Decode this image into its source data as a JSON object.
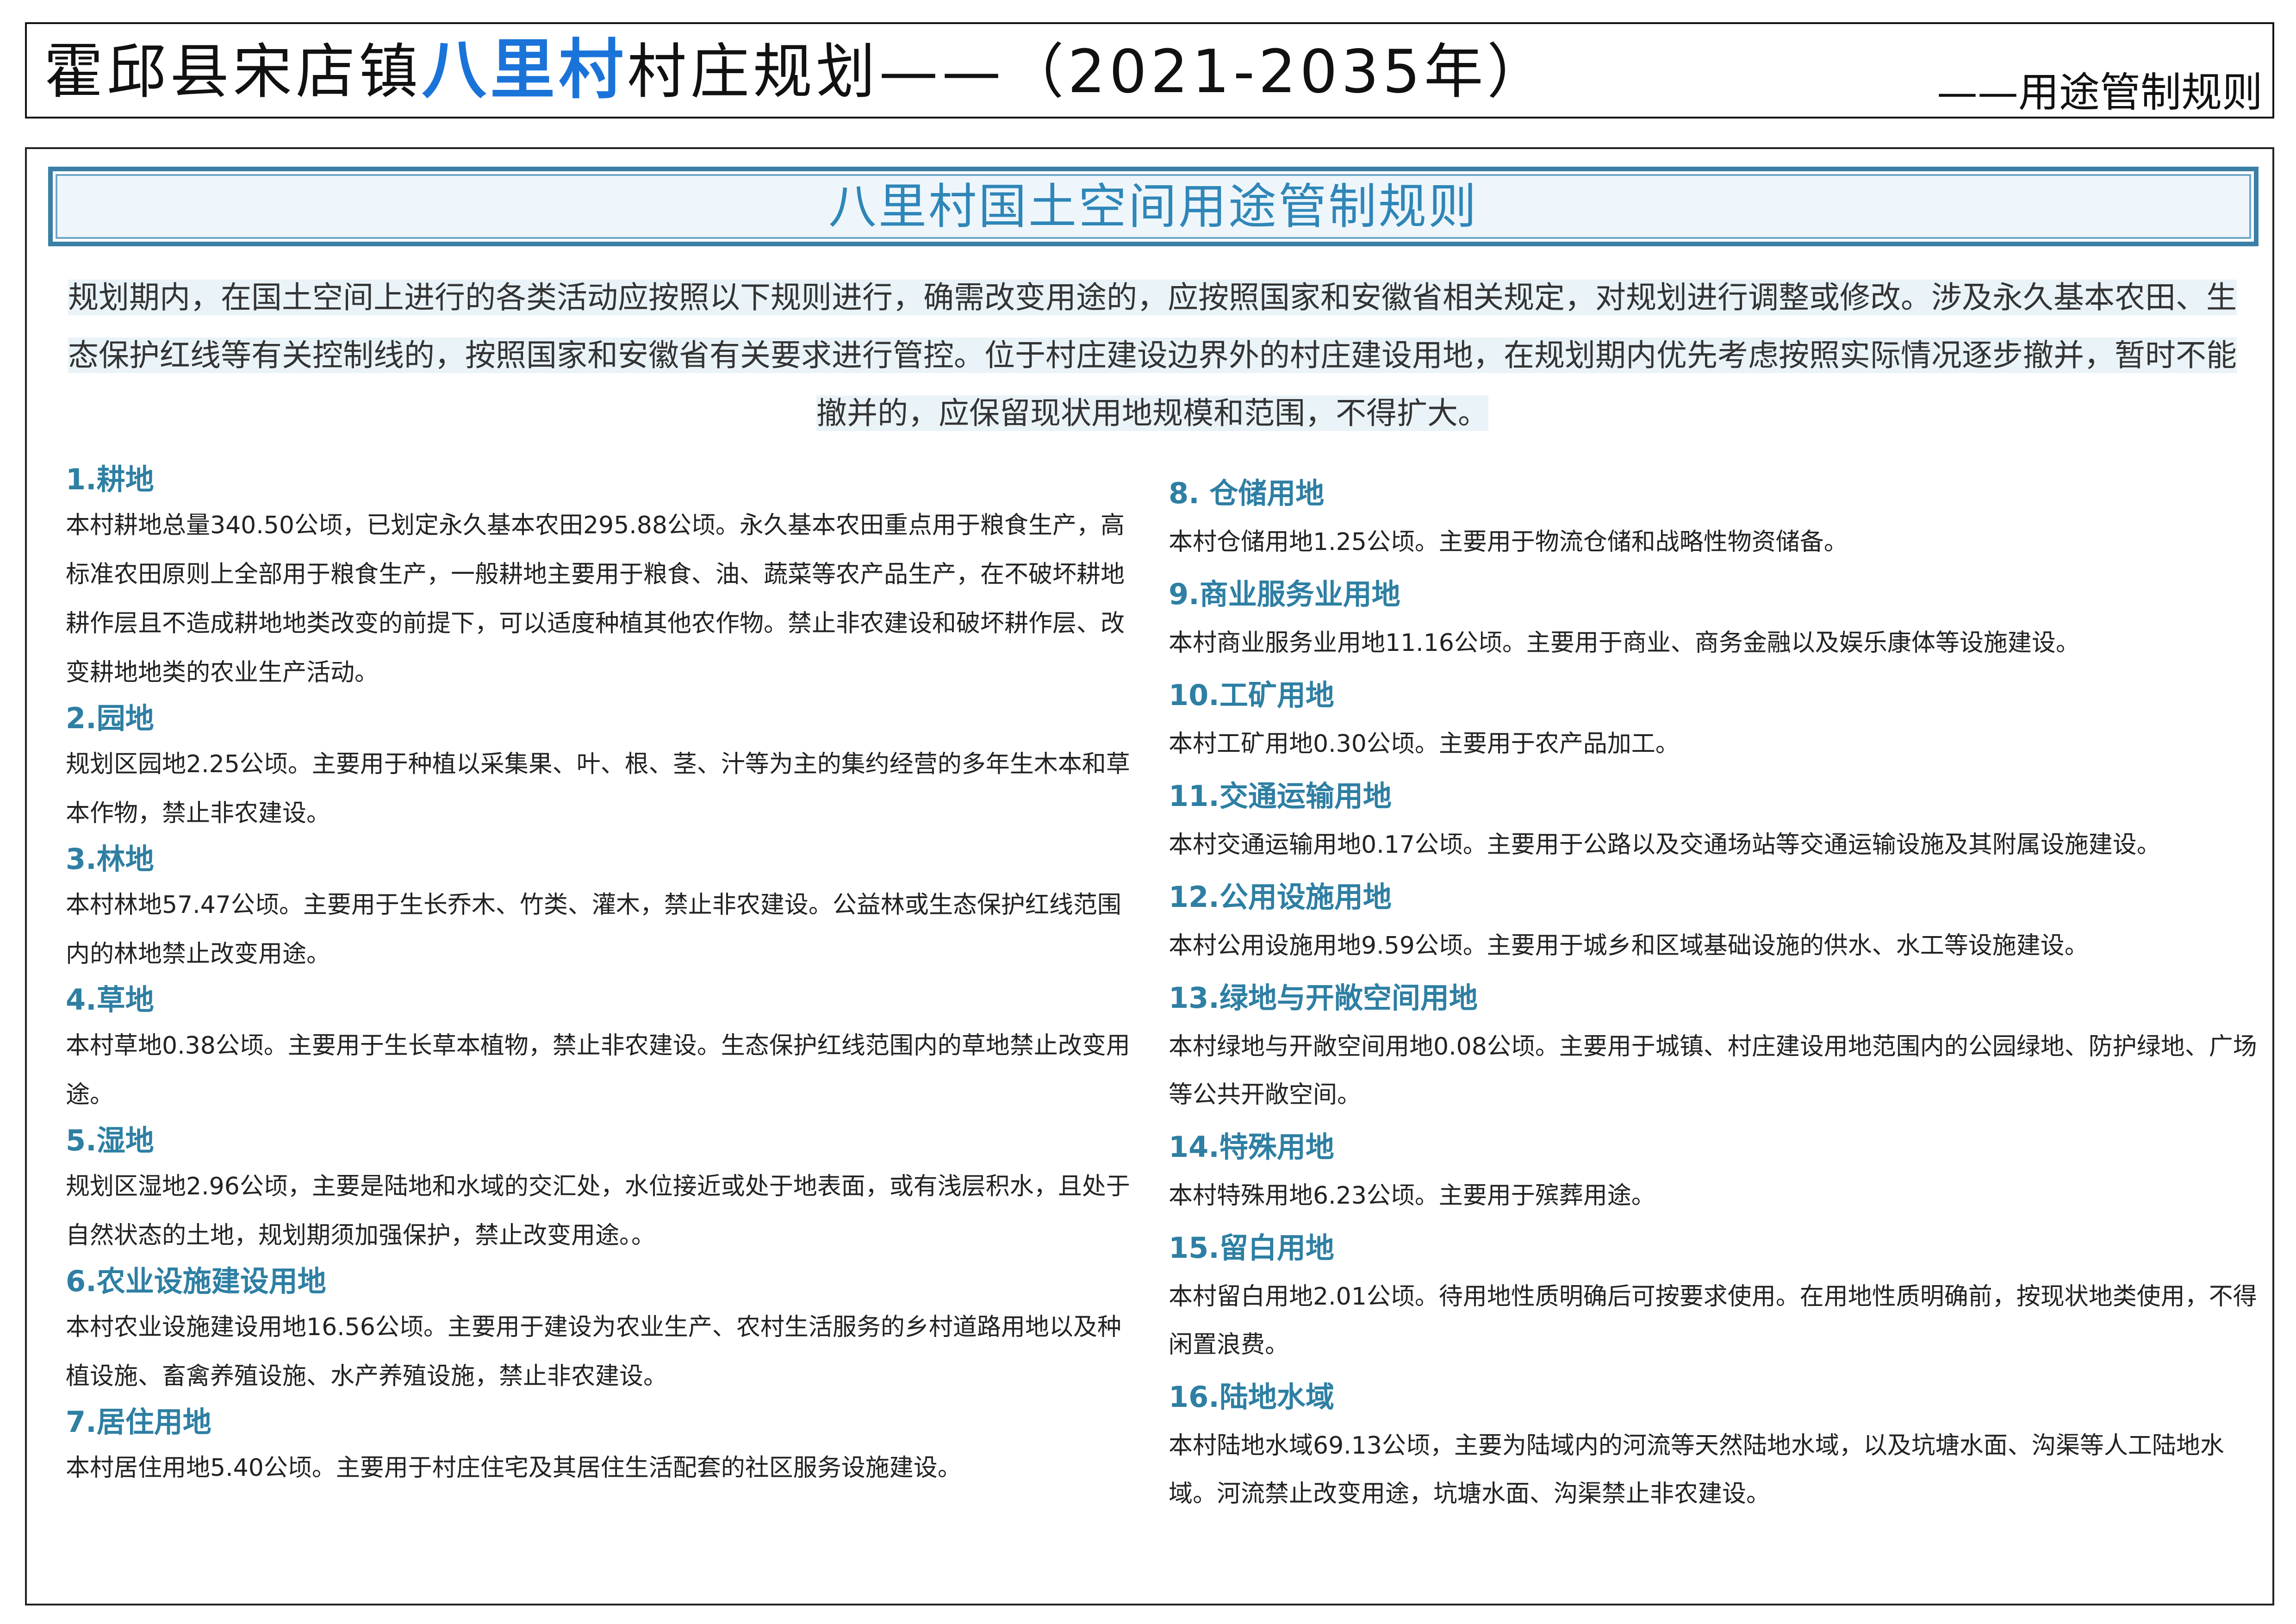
{
  "header": {
    "title_prefix": "霍邱县宋店镇",
    "title_village": "八里村",
    "title_suffix": "村庄规划——（2021-2035年）",
    "subtitle": "——用途管制规则"
  },
  "section": {
    "title": "八里村国土空间用途管制规则",
    "intro": "规划期内，在国土空间上进行的各类活动应按照以下规则进行，确需改变用途的，应按照国家和安徽省相关规定，对规划进行调整或修改。涉及永久基本农田、生态保护红线等有关控制线的，按照国家和安徽省有关要求进行管控。位于村庄建设边界外的村庄建设用地，在规划期内优先考虑按照实际情况逐步撤并，暂时不能撤并的，应保留现状用地规模和范围，不得扩大。"
  },
  "left_items": [
    {
      "title": "1.耕地",
      "body": "本村耕地总量340.50公顷，已划定永久基本农田295.88公顷。永久基本农田重点用于粮食生产，高标准农田原则上全部用于粮食生产，一般耕地主要用于粮食、油、蔬菜等农产品生产，在不破坏耕地耕作层且不造成耕地地类改变的前提下，可以适度种植其他农作物。禁止非农建设和破坏耕作层、改变耕地地类的农业生产活动。"
    },
    {
      "title": "2.园地",
      "body": "规划区园地2.25公顷。主要用于种植以采集果、叶、根、茎、汁等为主的集约经营的多年生木本和草本作物，禁止非农建设。"
    },
    {
      "title": "3.林地",
      "body": "本村林地57.47公顷。主要用于生长乔木、竹类、灌木，禁止非农建设。公益林或生态保护红线范围内的林地禁止改变用途。"
    },
    {
      "title": "4.草地",
      "body": "本村草地0.38公顷。主要用于生长草本植物，禁止非农建设。生态保护红线范围内的草地禁止改变用途。"
    },
    {
      "title": "5.湿地",
      "body": "规划区湿地2.96公顷，主要是陆地和水域的交汇处，水位接近或处于地表面，或有浅层积水，且处于自然状态的土地，规划期须加强保护，禁止改变用途。。"
    },
    {
      "title": "6.农业设施建设用地",
      "body": "本村农业设施建设用地16.56公顷。主要用于建设为农业生产、农村生活服务的乡村道路用地以及种植设施、畜禽养殖设施、水产养殖设施，禁止非农建设。"
    },
    {
      "title": "7.居住用地",
      "body": "本村居住用地5.40公顷。主要用于村庄住宅及其居住生活配套的社区服务设施建设。"
    }
  ],
  "right_items": [
    {
      "title": "8. 仓储用地",
      "body": "本村仓储用地1.25公顷。主要用于物流仓储和战略性物资储备。"
    },
    {
      "title": "9.商业服务业用地",
      "body": "本村商业服务业用地11.16公顷。主要用于商业、商务金融以及娱乐康体等设施建设。"
    },
    {
      "title": "10.工矿用地",
      "body": "本村工矿用地0.30公顷。主要用于农产品加工。"
    },
    {
      "title": "11.交通运输用地",
      "body": "本村交通运输用地0.17公顷。主要用于公路以及交通场站等交通运输设施及其附属设施建设。"
    },
    {
      "title": "12.公用设施用地",
      "body": "本村公用设施用地9.59公顷。主要用于城乡和区域基础设施的供水、水工等设施建设。"
    },
    {
      "title": "13.绿地与开敞空间用地",
      "body": "本村绿地与开敞空间用地0.08公顷。主要用于城镇、村庄建设用地范围内的公园绿地、防护绿地、广场等公共开敞空间。"
    },
    {
      "title": "14.特殊用地",
      "body": "本村特殊用地6.23公顷。主要用于殡葬用途。"
    },
    {
      "title": "15.留白用地",
      "body": "本村留白用地2.01公顷。待用地性质明确后可按要求使用。在用地性质明确前，按现状地类使用，不得闲置浪费。"
    },
    {
      "title": "16.陆地水域",
      "body": "本村陆地水域69.13公顷，主要为陆域内的河流等天然陆地水域，以及坑塘水面、沟渠等人工陆地水域。河流禁止改变用途，坑塘水面、沟渠禁止非农建设。"
    }
  ]
}
